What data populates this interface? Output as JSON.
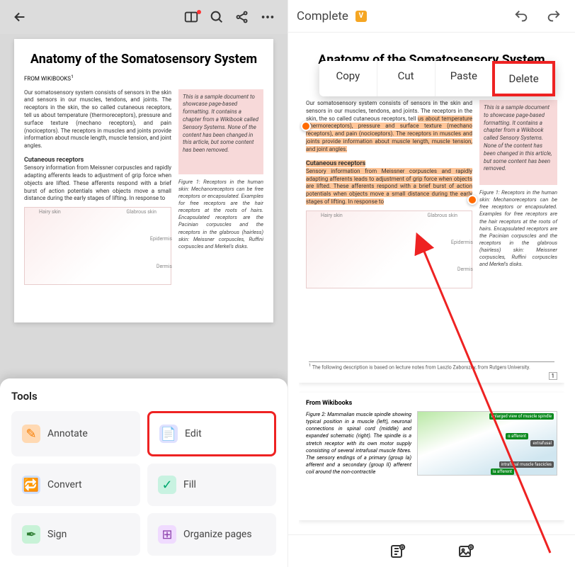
{
  "left": {
    "doc": {
      "title": "Anatomy of the Somatosensory System",
      "source": "FROM WIKIBOOKS",
      "source_sup": "1",
      "para1": "Our somatosensory system consists of sensors in the skin and sensors in our muscles, tendons, and joints. The receptors in the skin, the so called cutaneous receptors, tell us about temperature (thermoreceptors), pressure and surface texture (mechano receptors), and pain (nociceptors). The receptors in muscles and joints provide information about muscle length, muscle tension, and joint angles.",
      "subhead": "Cutaneous receptors",
      "para2": "Sensory information from Meissner corpuscles and rapidly adapting afferents leads to adjustment of grip force when objects are lifted. These afferents respond with a brief burst of action potentials when objects move a small distance during the early stages of lifting. In response to",
      "sidebox": "This is a sample document to showcase page-based formatting. It contains a chapter from a Wikibook called Sensory Systems. None of the content has been changed in this article, but some content has been removed.",
      "fig_caption": "Figure 1: Receptors in the human skin: Mechanoreceptors can be free receptors or encapsulated. Examples for free receptors are the hair receptors at the roots of hairs. Encapsulated receptors are the Pacinian corpuscles and the receptors in the glabrous (hairless) skin: Meissner corpuscles, Ruffini corpuscles and Merkel's disks.",
      "diagram_labels": {
        "a": "Hairy skin",
        "b": "Glabrous skin",
        "c": "Epidermis",
        "d": "Dermis"
      }
    },
    "tools": {
      "heading": "Tools",
      "items": [
        {
          "key": "annotate",
          "label": "Annotate"
        },
        {
          "key": "edit",
          "label": "Edit"
        },
        {
          "key": "convert",
          "label": "Convert"
        },
        {
          "key": "fill",
          "label": "Fill"
        },
        {
          "key": "sign",
          "label": "Sign"
        },
        {
          "key": "organize",
          "label": "Organize pages"
        }
      ]
    }
  },
  "right": {
    "topbar": {
      "title": "Complete",
      "badge": "V"
    },
    "context_menu": {
      "copy": "Copy",
      "cut": "Cut",
      "paste": "Paste",
      "delete": "Delete"
    },
    "doc": {
      "title": "Anatomy of the Somatosensory System",
      "para1a": "Our somatosensory system consists of sensors in the skin and sensors in our muscles, tendons, and joints. The receptors in the skin, the so called cutaneous receptors, tell ",
      "para1b_hl": "us about temperature (thermoreceptors), pressure and surface texture (mechano receptors), and pain (nociceptors). The receptors in muscles and joints provide information about muscle length, muscle tension, and joint angles.",
      "subhead_hl": "Cutaneous receptors",
      "para2_hl": "Sensory information from Meissner corpuscles and rapidly adapting afferents leads to adjustment of grip force when objects are lifted. These afferents respond with a brief burst of action potentials when objects move a small distance during the early stages of lifting. In response to",
      "sidebox": "This is a sample document to showcase page-based formatting. It contains a chapter from a Wikibook called Sensory Systems. None of the content has been changed in this article, but some content has been removed.",
      "fig_caption": "Figure 1: Receptors in the human skin: Mechanoreceptors can be free receptors or encapsulated. Examples for free receptors are the hair receptors at the roots of hairs. Encapsulated receptors are the Pacinian corpuscles and the receptors in the glabrous (hairless) skin: Meissner corpuscles, Ruffini corpuscles and Merkel's disks.",
      "footnote": "The following description is based on lecture notes from Laszlo Zaborszky, from Rutgers University.",
      "page_num": "1"
    },
    "doc2": {
      "source": "From Wikibooks",
      "fig_caption": "Figure 2: Mammalian muscle spindle showing typical position in a muscle (left), neuronal connections in spinal cord (middle) and expanded schematic (right). The spindle is a stretch receptor with its own motor supply consisting of several intrafusal muscle fibres. The sensory endings of a primary (group Ia) afferent and a secondary (group II) afferent coil around the non-contractile",
      "labels": {
        "a": "α afferent",
        "b": "Ia afferent",
        "c": "extrafusal",
        "d": "intrafusal muscle fascicles",
        "e": "enlarged view of muscle spindle"
      }
    }
  }
}
